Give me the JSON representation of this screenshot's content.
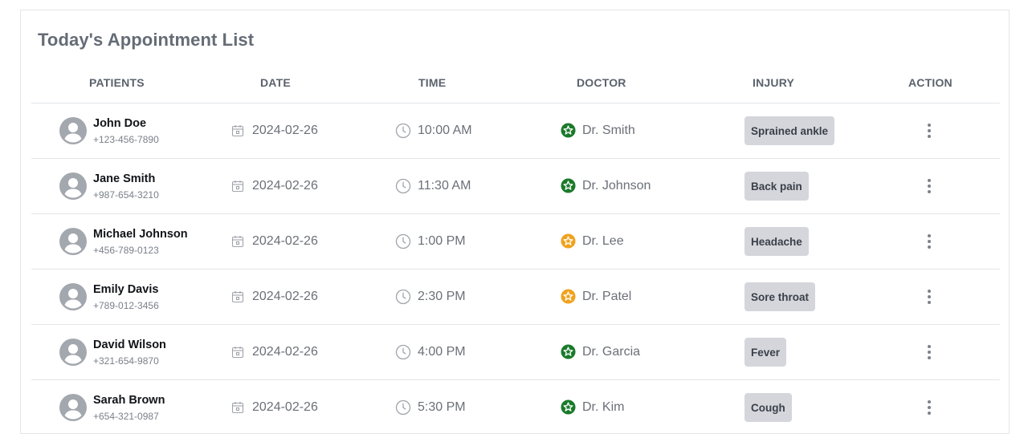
{
  "title": "Today's Appointment List",
  "columns": {
    "patients": "PATIENTS",
    "date": "DATE",
    "time": "TIME",
    "doctor": "DOCTOR",
    "injury": "INJURY",
    "action": "ACTION"
  },
  "icons": {
    "avatar": "user-avatar-icon",
    "date": "calendar-icon",
    "time": "clock-icon",
    "doctor": "star-badge-icon",
    "action": "kebab-menu-icon"
  },
  "colors": {
    "status_green": "#1a7a2b",
    "status_orange": "#f0a21e"
  },
  "appointments": [
    {
      "name": "John Doe",
      "phone": "+123-456-7890",
      "date": "2024-02-26",
      "time": "10:00 AM",
      "doctor": "Dr. Smith",
      "status": "green",
      "injury": "Sprained ankle"
    },
    {
      "name": "Jane Smith",
      "phone": "+987-654-3210",
      "date": "2024-02-26",
      "time": "11:30 AM",
      "doctor": "Dr. Johnson",
      "status": "green",
      "injury": "Back pain"
    },
    {
      "name": "Michael Johnson",
      "phone": "+456-789-0123",
      "date": "2024-02-26",
      "time": "1:00 PM",
      "doctor": "Dr. Lee",
      "status": "orange",
      "injury": "Headache"
    },
    {
      "name": "Emily Davis",
      "phone": "+789-012-3456",
      "date": "2024-02-26",
      "time": "2:30 PM",
      "doctor": "Dr. Patel",
      "status": "orange",
      "injury": "Sore throat"
    },
    {
      "name": "David Wilson",
      "phone": "+321-654-9870",
      "date": "2024-02-26",
      "time": "4:00 PM",
      "doctor": "Dr. Garcia",
      "status": "green",
      "injury": "Fever"
    },
    {
      "name": "Sarah Brown",
      "phone": "+654-321-0987",
      "date": "2024-02-26",
      "time": "5:30 PM",
      "doctor": "Dr. Kim",
      "status": "green",
      "injury": "Cough"
    }
  ]
}
